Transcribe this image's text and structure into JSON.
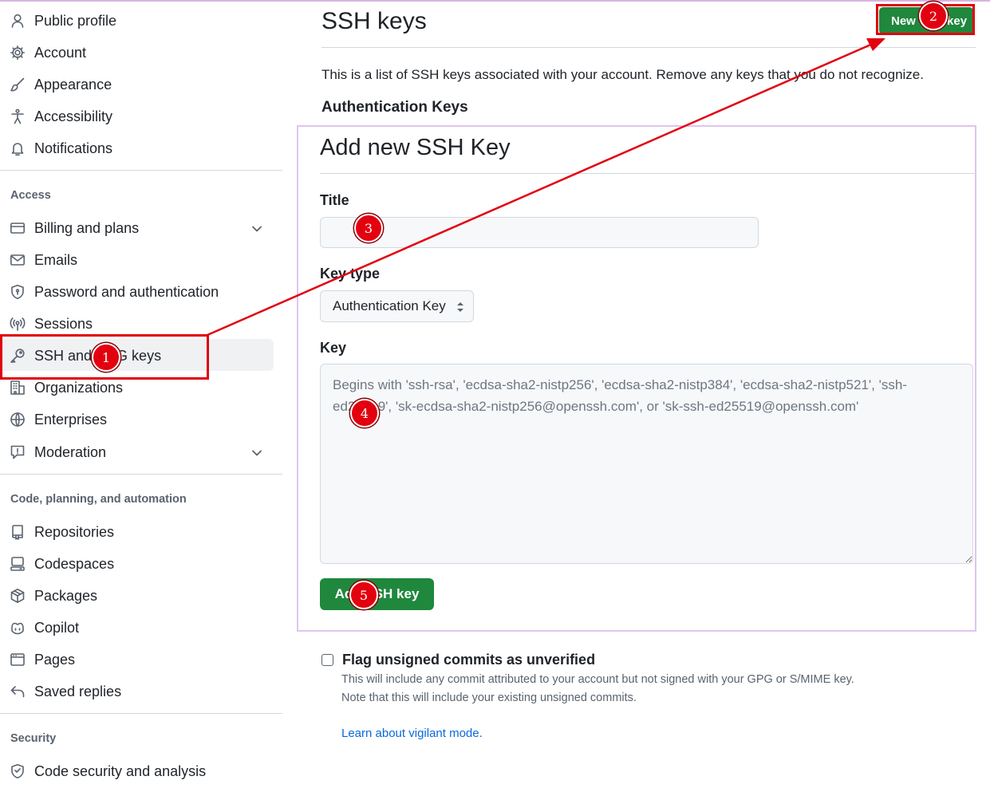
{
  "sidebar": {
    "top_items": [
      {
        "label": "Public profile",
        "icon": "person-icon"
      },
      {
        "label": "Account",
        "icon": "gear-icon"
      },
      {
        "label": "Appearance",
        "icon": "paintbrush-icon"
      },
      {
        "label": "Accessibility",
        "icon": "accessibility-icon"
      },
      {
        "label": "Notifications",
        "icon": "bell-icon"
      }
    ],
    "access": {
      "heading": "Access",
      "items": [
        {
          "label": "Billing and plans",
          "icon": "credit-card-icon"
        },
        {
          "label": "Emails",
          "icon": "mail-icon"
        },
        {
          "label": "Password and authentication",
          "icon": "shield-icon"
        },
        {
          "label": "Sessions",
          "icon": "broadcast-icon"
        },
        {
          "label": "SSH and GPG keys",
          "icon": "key-icon"
        },
        {
          "label": "Organizations",
          "icon": "organization-icon"
        },
        {
          "label": "Enterprises",
          "icon": "globe-icon"
        },
        {
          "label": "Moderation",
          "icon": "report-icon"
        }
      ]
    },
    "code": {
      "heading": "Code, planning, and automation",
      "items": [
        {
          "label": "Repositories",
          "icon": "repo-icon"
        },
        {
          "label": "Codespaces",
          "icon": "codespaces-icon"
        },
        {
          "label": "Packages",
          "icon": "package-icon"
        },
        {
          "label": "Copilot",
          "icon": "copilot-icon"
        },
        {
          "label": "Pages",
          "icon": "browser-icon"
        },
        {
          "label": "Saved replies",
          "icon": "reply-icon"
        }
      ]
    },
    "security": {
      "heading": "Security",
      "items": [
        {
          "label": "Code security and analysis",
          "icon": "codescan-icon"
        }
      ]
    }
  },
  "main": {
    "title": "SSH keys",
    "new_key_label": "New SSH key",
    "intro": "This is a list of SSH keys associated with your account. Remove any keys that you do not recognize.",
    "auth_heading": "Authentication Keys"
  },
  "modal": {
    "title": "Add new SSH Key",
    "title_label": "Title",
    "title_value": "",
    "key_type_label": "Key type",
    "key_type_value": "Authentication Key",
    "key_label": "Key",
    "key_placeholder": "Begins with 'ssh-rsa', 'ecdsa-sha2-nistp256', 'ecdsa-sha2-nistp384', 'ecdsa-sha2-nistp521', 'ssh-ed25519', 'sk-ecdsa-sha2-nistp256@openssh.com', or 'sk-ssh-ed25519@openssh.com'",
    "submit_label": "Add SSH key"
  },
  "vigilant": {
    "label": "Flag unsigned commits as unverified",
    "note_1": "This will include any commit attributed to your account but not signed with your GPG or S/MIME key.",
    "note_2": "Note that this will include your existing unsigned commits.",
    "link": "Learn about vigilant mode."
  },
  "annotations": {
    "badges": [
      "1",
      "2",
      "3",
      "4",
      "5"
    ],
    "color": "#e3000f"
  },
  "colors": {
    "primary_button": "#1f883d",
    "link": "#0969da",
    "annotation": "#e3000f"
  }
}
